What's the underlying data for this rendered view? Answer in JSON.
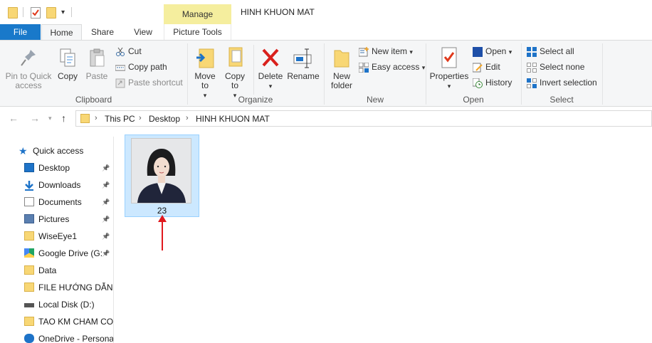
{
  "titlebar": {
    "context_tab": "Manage",
    "window_title": "HINH KHUON MAT"
  },
  "tabs": {
    "file": "File",
    "home": "Home",
    "share": "Share",
    "view": "View",
    "picture_tools": "Picture Tools"
  },
  "ribbon": {
    "clipboard": {
      "label": "Clipboard",
      "pin": "Pin to Quick access",
      "copy": "Copy",
      "paste": "Paste",
      "cut": "Cut",
      "copy_path": "Copy path",
      "paste_shortcut": "Paste shortcut"
    },
    "organize": {
      "label": "Organize",
      "move_to": "Move to",
      "copy_to": "Copy to",
      "delete": "Delete",
      "rename": "Rename"
    },
    "new": {
      "label": "New",
      "new_folder": "New folder",
      "new_item": "New item",
      "easy_access": "Easy access"
    },
    "open": {
      "label": "Open",
      "properties": "Properties",
      "open": "Open",
      "edit": "Edit",
      "history": "History"
    },
    "select": {
      "label": "Select",
      "select_all": "Select all",
      "select_none": "Select none",
      "invert_selection": "Invert selection"
    }
  },
  "address": {
    "crumbs": [
      "This PC",
      "Desktop",
      "HINH KHUON MAT"
    ]
  },
  "navpane": {
    "quick_access": "Quick access",
    "items": [
      {
        "label": "Desktop",
        "icon": "desktop-icon",
        "pinned": true
      },
      {
        "label": "Downloads",
        "icon": "download-icon",
        "pinned": true
      },
      {
        "label": "Documents",
        "icon": "documents-icon",
        "pinned": true
      },
      {
        "label": "Pictures",
        "icon": "pictures-icon",
        "pinned": true
      },
      {
        "label": "WiseEye1",
        "icon": "folder-icon",
        "pinned": true
      },
      {
        "label": "Google Drive (G:",
        "icon": "google-drive-icon",
        "pinned": true
      },
      {
        "label": "Data",
        "icon": "folder-icon",
        "pinned": false
      },
      {
        "label": "FILE HƯỚNG DẪN",
        "icon": "folder-icon",
        "pinned": false
      },
      {
        "label": "Local Disk (D:)",
        "icon": "drive-icon",
        "pinned": false
      },
      {
        "label": "TAO KM CHAM CO",
        "icon": "folder-icon",
        "pinned": false
      },
      {
        "label": "OneDrive - Personal",
        "icon": "onedrive-icon",
        "pinned": false
      }
    ]
  },
  "files": [
    {
      "name": "23",
      "selected": true
    }
  ],
  "colors": {
    "file_tab": "#1979ca",
    "context_tab": "#f5ee9e",
    "selection": "#cce8ff",
    "annotation_arrow": "#e0191e"
  }
}
